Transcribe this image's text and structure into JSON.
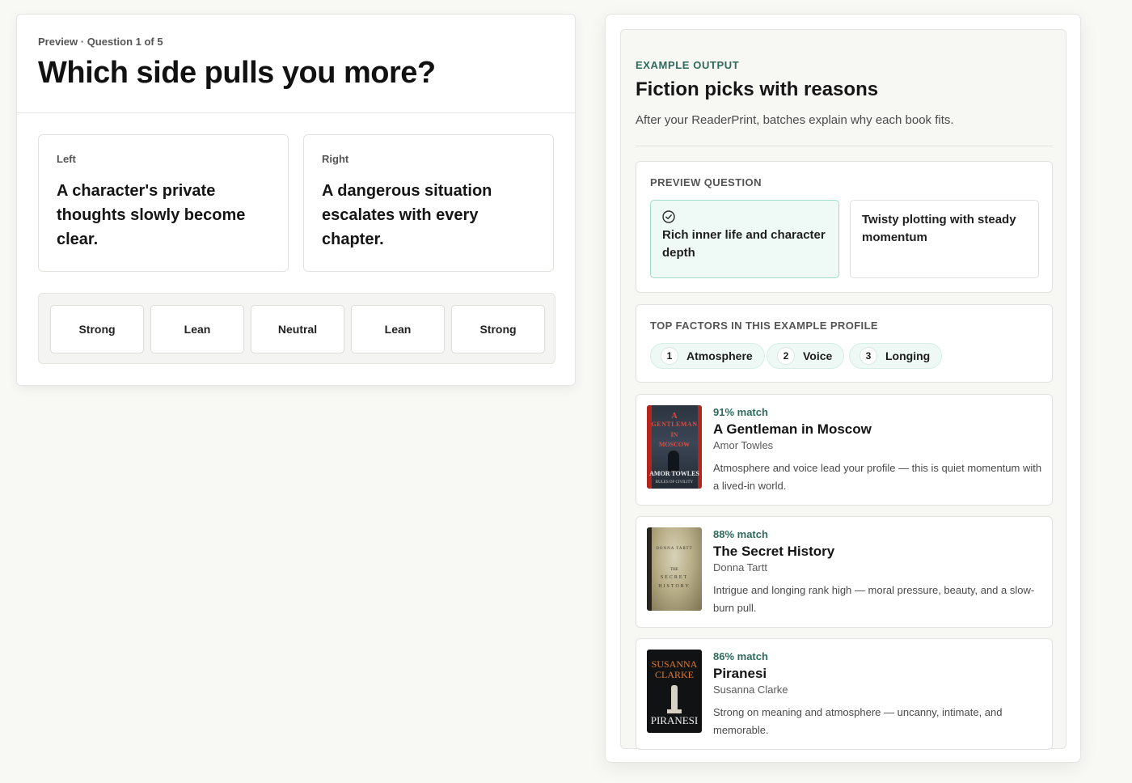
{
  "left": {
    "eyebrow": "Preview · Question 1 of 5",
    "title": "Which side pulls you more?",
    "left_choice": {
      "label": "Left",
      "text": "A character's private thoughts slowly become clear."
    },
    "right_choice": {
      "label": "Right",
      "text": "A dangerous situation escalates with every chapter."
    },
    "scale": [
      "Strong",
      "Lean",
      "Neutral",
      "Lean",
      "Strong"
    ]
  },
  "right": {
    "eyebrow": "EXAMPLE OUTPUT",
    "title": "Fiction picks with reasons",
    "subtitle": "After your ReaderPrint, batches explain why each book fits.",
    "preview_question": {
      "eyebrow": "PREVIEW QUESTION",
      "selected": "Rich inner life and character depth",
      "other": "Twisty plotting with steady momentum"
    },
    "factors": {
      "eyebrow": "TOP FACTORS IN THIS EXAMPLE PROFILE",
      "items": [
        {
          "num": "1",
          "label": "Atmosphere"
        },
        {
          "num": "2",
          "label": "Voice"
        },
        {
          "num": "3",
          "label": "Longing"
        }
      ]
    },
    "books": [
      {
        "match": "91% match",
        "title": "A Gentleman in Moscow",
        "author": "Amor Towles",
        "desc": "Atmosphere and voice lead your profile — this is quiet momentum with a lived-in world.",
        "cover_lines": [
          "A",
          "GENTLEMAN",
          "IN",
          "MOSCOW",
          "AMOR TOWLES",
          "RULES OF CIVILITY"
        ]
      },
      {
        "match": "88% match",
        "title": "The Secret History",
        "author": "Donna Tartt",
        "desc": "Intrigue and longing rank high — moral pressure, beauty, and a slow-burn pull.",
        "cover_lines": [
          "DONNA TARTT",
          "THE",
          "SECRET",
          "HISTORY"
        ]
      },
      {
        "match": "86% match",
        "title": "Piranesi",
        "author": "Susanna Clarke",
        "desc": "Strong on meaning and atmosphere — uncanny, intimate, and memorable.",
        "cover_lines": [
          "SUSANNA",
          "CLARKE",
          "PIRANESI"
        ]
      }
    ]
  },
  "colors": {
    "accent": "#2f6b5c",
    "selected_bg": "#effaf6",
    "selected_border": "#9fdcc8",
    "background": "#f8f8f5"
  }
}
